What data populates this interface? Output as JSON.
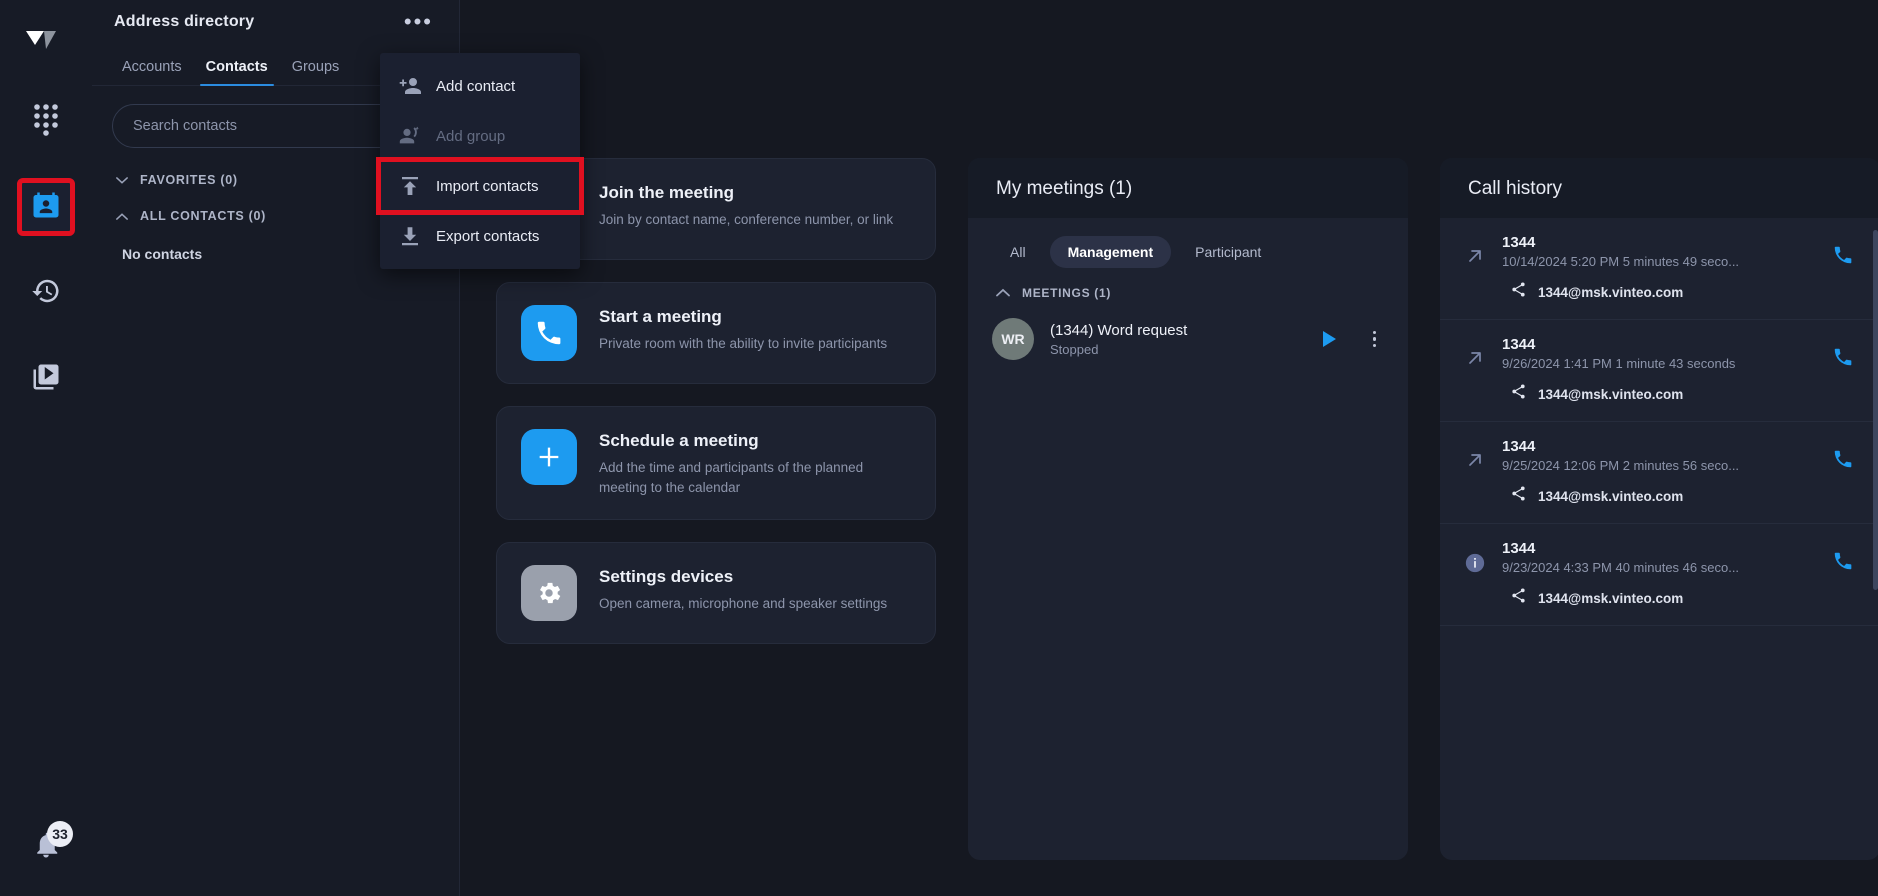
{
  "rail": {
    "logo_icon": "vinteo-logo-icon",
    "items": [
      {
        "name": "dialpad",
        "icon": "dialpad-icon",
        "active": false
      },
      {
        "name": "address-directory",
        "icon": "contacts-card-icon",
        "active": true
      },
      {
        "name": "call-history",
        "icon": "history-clock-icon",
        "active": false
      },
      {
        "name": "recordings",
        "icon": "video-library-icon",
        "active": false
      }
    ],
    "notifications": {
      "icon": "bell-icon",
      "badge": "33"
    }
  },
  "directory": {
    "title": "Address directory",
    "more_icon": "ellipsis-icon",
    "tabs": [
      {
        "label": "Accounts",
        "active": false
      },
      {
        "label": "Contacts",
        "active": true
      },
      {
        "label": "Groups",
        "active": false
      }
    ],
    "search": {
      "placeholder": "Search contacts",
      "value": ""
    },
    "groups": [
      {
        "label": "FAVORITES (0)",
        "caret": "chevron-down-icon"
      },
      {
        "label": "ALL CONTACTS (0)",
        "caret": "chevron-up-icon"
      }
    ],
    "empty_text": "No contacts"
  },
  "context_menu": {
    "items": [
      {
        "label": "Add contact",
        "icon": "person-add-icon",
        "disabled": false,
        "highlighted": false
      },
      {
        "label": "Add group",
        "icon": "group-add-icon",
        "disabled": true,
        "highlighted": false
      },
      {
        "label": "Import contacts",
        "icon": "upload-icon",
        "disabled": false,
        "highlighted": true
      },
      {
        "label": "Export contacts",
        "icon": "download-icon",
        "disabled": false,
        "highlighted": false
      }
    ],
    "highlight_color": "#e01020"
  },
  "cards": [
    {
      "title": "Join the meeting",
      "subtitle": "Join by contact name, conference number, or link",
      "icon": "none",
      "icon_style": "none"
    },
    {
      "title": "Start a meeting",
      "subtitle": "Private room with the ability to invite participants",
      "icon": "phone-icon",
      "icon_style": "blue"
    },
    {
      "title": "Schedule a meeting",
      "subtitle": "Add the time and participants of the planned meeting to the calendar",
      "icon": "plus-icon",
      "icon_style": "blue"
    },
    {
      "title": "Settings devices",
      "subtitle": "Open camera, microphone and speaker settings",
      "icon": "gear-icon",
      "icon_style": "grey"
    }
  ],
  "meetings": {
    "title": "My meetings (1)",
    "segments": [
      {
        "label": "All",
        "active": false
      },
      {
        "label": "Management",
        "active": true
      },
      {
        "label": "Participant",
        "active": false
      }
    ],
    "group_label": "MEETINGS (1)",
    "group_caret": "chevron-up-icon",
    "rows": [
      {
        "avatar": "WR",
        "name": "(1344) Word request",
        "state": "Stopped",
        "play_icon": "play-icon",
        "menu_icon": "kebab-menu-icon"
      }
    ]
  },
  "call_history": {
    "title": "Call history",
    "items": [
      {
        "direction_icon": "outgoing-call-arrow-icon",
        "number": "1344",
        "meta": "10/14/2024 5:20 PM  5 minutes 49 seco...",
        "address": "1344@msk.vinteo.com",
        "address_icon": "share-icon",
        "call_icon": "phone-icon"
      },
      {
        "direction_icon": "outgoing-call-arrow-icon",
        "number": "1344",
        "meta": "9/26/2024 1:41 PM  1 minute 43 seconds",
        "address": "1344@msk.vinteo.com",
        "address_icon": "share-icon",
        "call_icon": "phone-icon"
      },
      {
        "direction_icon": "outgoing-call-arrow-icon",
        "number": "1344",
        "meta": "9/25/2024 12:06 PM  2 minutes 56 seco...",
        "address": "1344@msk.vinteo.com",
        "address_icon": "share-icon",
        "call_icon": "phone-icon"
      },
      {
        "direction_icon": "info-icon",
        "number": "1344",
        "meta": "9/23/2024 4:33 PM  40 minutes 46 seco...",
        "address": "1344@msk.vinteo.com",
        "address_icon": "share-icon",
        "call_icon": "phone-icon"
      }
    ]
  },
  "colors": {
    "accent_blue": "#1d9bf0",
    "highlight_red": "#e01020",
    "panel_bg": "#1d2230",
    "app_bg": "#151821"
  }
}
